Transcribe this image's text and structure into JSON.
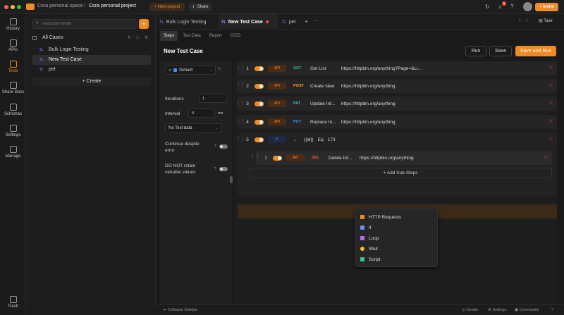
{
  "topbar": {
    "space": "Cora personal space",
    "project": "Cora personal project",
    "new_project": "+ New project",
    "share": "Share",
    "notif_count": "1",
    "invite": "Invite"
  },
  "nav": [
    {
      "label": "History"
    },
    {
      "label": "APIs"
    },
    {
      "label": "Tests"
    },
    {
      "label": "Share Docs"
    },
    {
      "label": "Schemas"
    },
    {
      "label": "Settings"
    },
    {
      "label": "Manage"
    },
    {
      "label": "Trash"
    }
  ],
  "sidebar": {
    "search_placeholder": "Testcase/Folder",
    "add": "+",
    "all_cases": "All Cases",
    "items": [
      "Bulk Login Testing",
      "New Test Case",
      "pet"
    ],
    "create": "+ Create"
  },
  "tabs": {
    "items": [
      "Bulk Login Testing",
      "New Test Case",
      "pet"
    ],
    "plus": "+",
    "more": "···",
    "task": "Task"
  },
  "subtabs": [
    "Steps",
    "Test Data",
    "Report",
    "CICD"
  ],
  "page": {
    "title": "New Test Case",
    "run": "Run",
    "save": "Save",
    "save_run": "Save and Run"
  },
  "settings": {
    "env": "Default",
    "iterations_label": "Iterations",
    "iterations_value": "1",
    "interval_label": "Interval",
    "interval_value": "0",
    "interval_unit": "ms",
    "test_data": "No Test data",
    "continue_label_1": "Continue despite",
    "continue_label_2": "error",
    "retain_label_1": "DO NOT retain",
    "retain_label_2": "variable values"
  },
  "steps": [
    {
      "num": "1",
      "tag": "API",
      "method": "GET",
      "method_color": "#3ec28f",
      "name": "Get List",
      "url": "https://httpbin.org/anything?Page=&Li..."
    },
    {
      "num": "2",
      "tag": "API",
      "method": "POST",
      "method_color": "#f0a020",
      "name": "Create New",
      "url": "https://httpbin.org/anything"
    },
    {
      "num": "3",
      "tag": "API",
      "method": "PAT",
      "method_color": "#3ec2b8",
      "name": "Update Inf...",
      "url": "https://httpbin.org/anything"
    },
    {
      "num": "4",
      "tag": "API",
      "method": "PUT",
      "method_color": "#4a8cf0",
      "name": "Replace In...",
      "url": "https://httpbin.org/anything"
    }
  ],
  "if_step": {
    "num": "5",
    "tag": "IF",
    "cond_var": "{{id}}",
    "cond_op": "Eq",
    "cond_val": "173"
  },
  "sub_step": {
    "num": "1",
    "tag": "API",
    "method": "DEL",
    "method_color": "#f0553a",
    "name": "Delete Inf...",
    "url": "https://httpbin.org/anything"
  },
  "add_sub": "+ Add Sub-Steps",
  "add_steps": "+ Add Steps",
  "menu": [
    {
      "label": "HTTP Requests",
      "color": "#f08a24"
    },
    {
      "label": "If",
      "color": "#6c8ef5"
    },
    {
      "label": "Loop",
      "color": "#b06cf5"
    },
    {
      "label": "Wait",
      "color": "#f0c020"
    },
    {
      "label": "Script",
      "color": "#3ec28f"
    }
  ],
  "footer": {
    "collapse": "Collapse Sidebar",
    "cookie": "Cookie",
    "settings": "Settings",
    "community": "Community"
  }
}
